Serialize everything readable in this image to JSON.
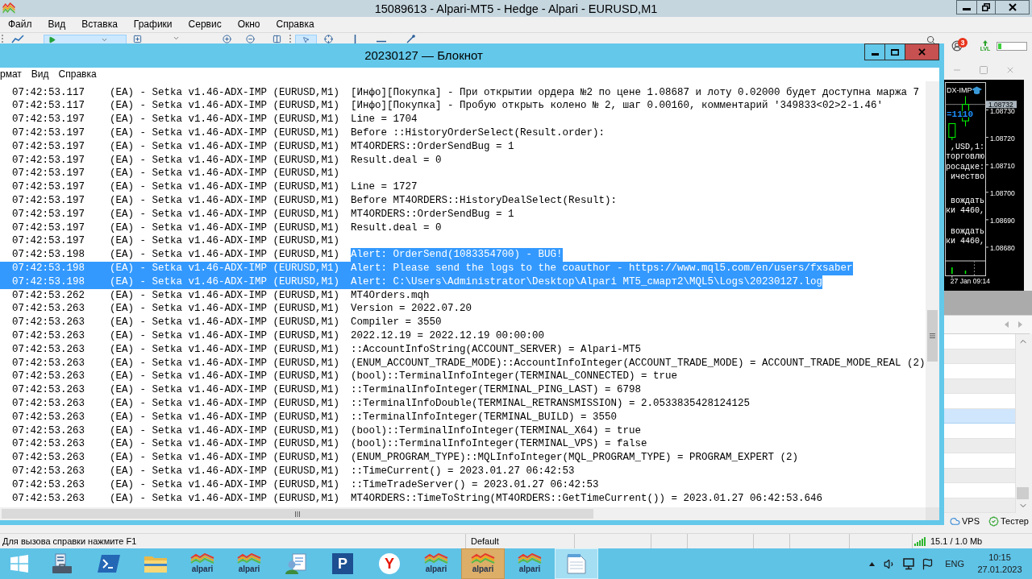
{
  "mt5": {
    "title": "15089613 - Alpari-MT5 - Hedge - Alpari - EURUSD,M1",
    "menu": [
      "Файл",
      "Вид",
      "Вставка",
      "Графики",
      "Сервис",
      "Окно",
      "Справка"
    ],
    "toolbar": {
      "notifications": "3",
      "level_label": "LVL",
      "level": 0.13
    },
    "chart": {
      "header": "DX-IMP",
      "value_label": "=1110",
      "time_label": "27 Jan 09:14",
      "comment_blocks": [
        [
          ",USD,1:",
          "торговлю",
          "росадке:",
          "ичество"
        ],
        [
          "вождать",
          "ки 4460,"
        ],
        [
          "вождать",
          "ки 4460,"
        ]
      ],
      "chart_data": {
        "type": "candlestick",
        "categories": [
          null,
          null,
          null
        ],
        "ohlc": [
          [
            1.0872,
            1.08725,
            1.08719,
            1.08725
          ],
          [
            1.08726,
            1.08735,
            1.08724,
            1.08732
          ],
          null
        ],
        "yticks": [
          {
            "value": 1.0873,
            "label": "1.08730"
          },
          {
            "value": 1.0872,
            "label": "1.08720"
          },
          {
            "value": 1.0871,
            "label": "1.08710"
          },
          {
            "value": 1.087,
            "label": "1.08700"
          },
          {
            "value": 1.0869,
            "label": "1.08690"
          },
          {
            "value": 1.0868,
            "label": "1.08680"
          }
        ],
        "ylim": [
          1.08675,
          1.08741
        ],
        "ref_lines": [
          {
            "axis": "y",
            "value": 1.08732,
            "label": "1.08732",
            "color": "#808080"
          }
        ]
      }
    },
    "list": {
      "rows": [
        {
          "selected": false
        },
        {
          "selected": false
        },
        {
          "selected": false
        },
        {
          "selected": false
        },
        {
          "selected": false
        },
        {
          "selected": true
        },
        {
          "selected": false
        },
        {
          "selected": false
        },
        {
          "selected": false
        },
        {
          "selected": false
        },
        {
          "selected": false
        },
        {
          "selected": false
        }
      ]
    },
    "bottom_tabs": [
      {
        "kind": "vps",
        "label": "VPS"
      },
      {
        "kind": "tester",
        "label": "Тестер"
      }
    ],
    "status_bar": {
      "help": "Для вызова справки нажмите F1",
      "profile": "Default",
      "traffic": "15.1 / 1.0 Mb"
    }
  },
  "notepad": {
    "title": "20230127 — Блокнот",
    "menu": [
      "рмат",
      "Вид",
      "Справка"
    ],
    "lines": [
      {
        "time": "07:42:53.117",
        "source": "(EA) - Setka v1.46-ADX-IMP (EURUSD,M1)",
        "message": "[Инфо][Покупка] - При открытии ордера №2 по цене 1.08687 и лоту 0.02000 будет доступна маржа 7",
        "selected": false
      },
      {
        "time": "07:42:53.117",
        "source": "(EA) - Setka v1.46-ADX-IMP (EURUSD,M1)",
        "message": "[Инфо][Покупка] - Пробую открыть колено № 2, шаг 0.00160, комментарий '349833<02>2-1.46'",
        "selected": false
      },
      {
        "time": "07:42:53.197",
        "source": "(EA) - Setka v1.46-ADX-IMP (EURUSD,M1)",
        "message": "Line = 1704",
        "selected": false
      },
      {
        "time": "07:42:53.197",
        "source": "(EA) - Setka v1.46-ADX-IMP (EURUSD,M1)",
        "message": "Before ::HistoryOrderSelect(Result.order):",
        "selected": false
      },
      {
        "time": "07:42:53.197",
        "source": "(EA) - Setka v1.46-ADX-IMP (EURUSD,M1)",
        "message": "MT4ORDERS::OrderSendBug = 1",
        "selected": false
      },
      {
        "time": "07:42:53.197",
        "source": "(EA) - Setka v1.46-ADX-IMP (EURUSD,M1)",
        "message": "Result.deal = 0",
        "selected": false
      },
      {
        "time": "07:42:53.197",
        "source": "(EA) - Setka v1.46-ADX-IMP (EURUSD,M1)",
        "selected": false
      },
      {
        "time": "07:42:53.197",
        "source": "(EA) - Setka v1.46-ADX-IMP (EURUSD,M1)",
        "message": "Line = 1727",
        "selected": false
      },
      {
        "time": "07:42:53.197",
        "source": "(EA) - Setka v1.46-ADX-IMP (EURUSD,M1)",
        "message": "Before MT4ORDERS::HistoryDealSelect(Result):",
        "selected": false
      },
      {
        "time": "07:42:53.197",
        "source": "(EA) - Setka v1.46-ADX-IMP (EURUSD,M1)",
        "message": "MT4ORDERS::OrderSendBug = 1",
        "selected": false
      },
      {
        "time": "07:42:53.197",
        "source": "(EA) - Setka v1.46-ADX-IMP (EURUSD,M1)",
        "message": "Result.deal = 0",
        "selected": false
      },
      {
        "time": "07:42:53.197",
        "source": "(EA) - Setka v1.46-ADX-IMP (EURUSD,M1)",
        "selected": false
      },
      {
        "time": "07:42:53.198",
        "source": "(EA) - Setka v1.46-ADX-IMP (EURUSD,M1)",
        "message": "Alert: OrderSend(1083354700) - BUG!",
        "selected": true,
        "selection_from_message": true
      },
      {
        "time": "07:42:53.198",
        "source": "(EA) - Setka v1.46-ADX-IMP (EURUSD,M1)",
        "message": "Alert: Please send the logs to the coauthor - https://www.mql5.com/en/users/fxsaber",
        "selected": true
      },
      {
        "time": "07:42:53.198",
        "source": "(EA) - Setka v1.46-ADX-IMP (EURUSD,M1)",
        "message": "Alert: C:\\Users\\Administrator\\Desktop\\Alpari MT5_смарт2\\MQL5\\Logs\\20230127.log",
        "selected": true
      },
      {
        "time": "07:42:53.262",
        "source": "(EA) - Setka v1.46-ADX-IMP (EURUSD,M1)",
        "message": "MT4Orders.mqh",
        "selected": false
      },
      {
        "time": "07:42:53.263",
        "source": "(EA) - Setka v1.46-ADX-IMP (EURUSD,M1)",
        "message": "Version = 2022.07.20",
        "selected": false
      },
      {
        "time": "07:42:53.263",
        "source": "(EA) - Setka v1.46-ADX-IMP (EURUSD,M1)",
        "message": "Compiler = 3550",
        "selected": false
      },
      {
        "time": "07:42:53.263",
        "source": "(EA) - Setka v1.46-ADX-IMP (EURUSD,M1)",
        "message": "2022.12.19 = 2022.12.19 00:00:00",
        "selected": false
      },
      {
        "time": "07:42:53.263",
        "source": "(EA) - Setka v1.46-ADX-IMP (EURUSD,M1)",
        "message": "::AccountInfoString(ACCOUNT_SERVER) = Alpari-MT5",
        "selected": false
      },
      {
        "time": "07:42:53.263",
        "source": "(EA) - Setka v1.46-ADX-IMP (EURUSD,M1)",
        "message": "(ENUM_ACCOUNT_TRADE_MODE)::AccountInfoInteger(ACCOUNT_TRADE_MODE) = ACCOUNT_TRADE_MODE_REAL (2)",
        "selected": false
      },
      {
        "time": "07:42:53.263",
        "source": "(EA) - Setka v1.46-ADX-IMP (EURUSD,M1)",
        "message": "(bool)::TerminalInfoInteger(TERMINAL_CONNECTED) = true",
        "selected": false
      },
      {
        "time": "07:42:53.263",
        "source": "(EA) - Setka v1.46-ADX-IMP (EURUSD,M1)",
        "message": "::TerminalInfoInteger(TERMINAL_PING_LAST) = 6798",
        "selected": false
      },
      {
        "time": "07:42:53.263",
        "source": "(EA) - Setka v1.46-ADX-IMP (EURUSD,M1)",
        "message": "::TerminalInfoDouble(TERMINAL_RETRANSMISSION) = 2.0533835428124125",
        "selected": false
      },
      {
        "time": "07:42:53.263",
        "source": "(EA) - Setka v1.46-ADX-IMP (EURUSD,M1)",
        "message": "::TerminalInfoInteger(TERMINAL_BUILD) = 3550",
        "selected": false
      },
      {
        "time": "07:42:53.263",
        "source": "(EA) - Setka v1.46-ADX-IMP (EURUSD,M1)",
        "message": "(bool)::TerminalInfoInteger(TERMINAL_X64) = true",
        "selected": false
      },
      {
        "time": "07:42:53.263",
        "source": "(EA) - Setka v1.46-ADX-IMP (EURUSD,M1)",
        "message": "(bool)::TerminalInfoInteger(TERMINAL_VPS) = false",
        "selected": false
      },
      {
        "time": "07:42:53.263",
        "source": "(EA) - Setka v1.46-ADX-IMP (EURUSD,M1)",
        "message": "(ENUM_PROGRAM_TYPE)::MQLInfoInteger(MQL_PROGRAM_TYPE) = PROGRAM_EXPERT (2)",
        "selected": false
      },
      {
        "time": "07:42:53.263",
        "source": "(EA) - Setka v1.46-ADX-IMP (EURUSD,M1)",
        "message": "::TimeCurrent() = 2023.01.27 06:42:53",
        "selected": false
      },
      {
        "time": "07:42:53.263",
        "source": "(EA) - Setka v1.46-ADX-IMP (EURUSD,M1)",
        "message": "::TimeTradeServer() = 2023.01.27 06:42:53",
        "selected": false
      },
      {
        "time": "07:42:53.263",
        "source": "(EA) - Setka v1.46-ADX-IMP (EURUSD,M1)",
        "message": "MT4ORDERS::TimeToString(MT4ORDERS::GetTimeCurrent()) = 2023.01.27 06:42:53.646",
        "selected": false
      }
    ]
  },
  "taskbar": {
    "items": [
      {
        "kind": "server_manager",
        "selected": false,
        "flashing": false
      },
      {
        "kind": "powershell",
        "selected": false,
        "flashing": false
      },
      {
        "kind": "explorer",
        "selected": false,
        "flashing": false
      },
      {
        "kind": "alpari",
        "label": "alpari",
        "selected": false,
        "flashing": false
      },
      {
        "kind": "alpari",
        "label": "alpari",
        "selected": false,
        "flashing": false
      },
      {
        "kind": "contacts",
        "selected": false,
        "flashing": false
      },
      {
        "kind": "letter_logo",
        "label": "P",
        "selected": false,
        "flashing": false
      },
      {
        "kind": "browser",
        "label": "Y",
        "selected": false,
        "flashing": false
      },
      {
        "kind": "alpari",
        "label": "alpari",
        "selected": false,
        "flashing": false
      },
      {
        "kind": "alpari",
        "label": "alpari",
        "selected": false,
        "flashing": true
      },
      {
        "kind": "alpari",
        "label": "alpari",
        "selected": false,
        "flashing": false
      },
      {
        "kind": "notepad",
        "selected": true,
        "flashing": false
      }
    ],
    "tray": {
      "language": "ENG",
      "time": "10:15",
      "date": "27.01.2023"
    }
  }
}
